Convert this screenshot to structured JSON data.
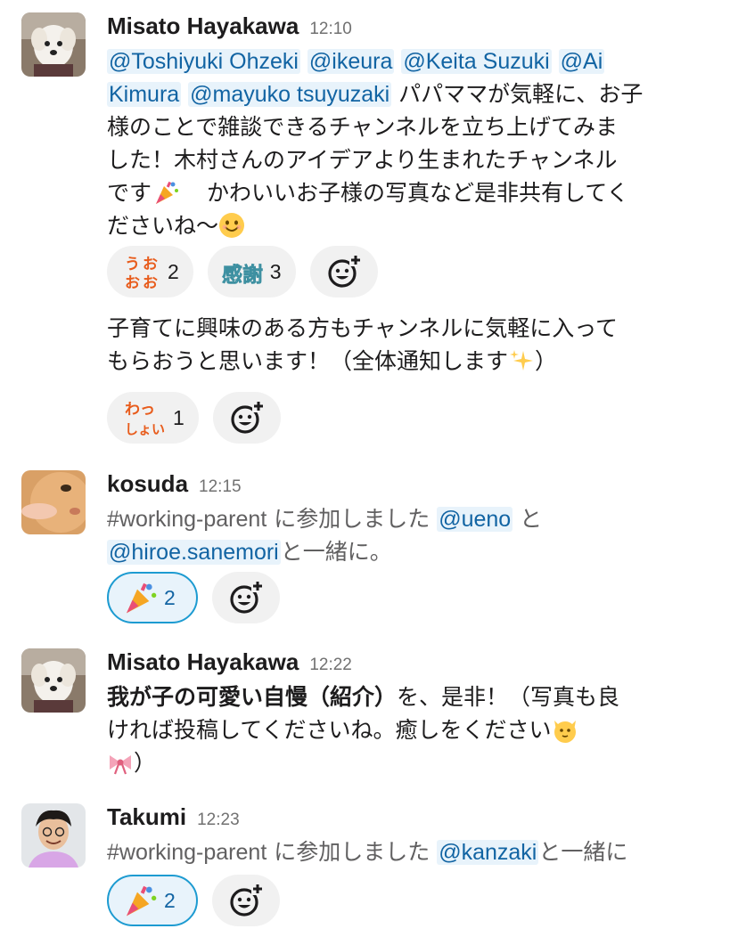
{
  "messages": [
    {
      "author": "Misato Hayakawa",
      "time": "12:10",
      "mentions": [
        "@Toshiyuki Ohzeki",
        "@ikeura",
        "@Keita Suzuki",
        "@Ai",
        "Kimura",
        "@mayuko tsuyuzaki"
      ],
      "text_1": "パパママが気軽に、お子",
      "text_2": "様のことで雑談できるチャンネルを立ち上げてみま",
      "text_3": "した！木村さんのアイデアより生まれたチャンネル",
      "text_4a": "です",
      "text_4b": "かわいいお子様の写真など是非共有してく",
      "text_5": "ださいね〜",
      "reactions": [
        {
          "emoji_name": "uooo-icon",
          "emoji_text": "うおおお",
          "count": "2"
        },
        {
          "emoji_name": "kansha-icon",
          "emoji_text": "感謝",
          "count": "3"
        }
      ],
      "followup_1": "子育てに興味のある方もチャンネルに気軽に入って",
      "followup_2": "もらおうと思います！（全体通知します",
      "followup_2_end": "）",
      "followup_reactions": [
        {
          "emoji_name": "wasshoi-icon",
          "emoji_text": "わっしょい",
          "count": "1"
        }
      ]
    },
    {
      "author": "kosuda",
      "time": "12:15",
      "channel": "#working-parent",
      "joined": "に参加しました",
      "mention_1": "@ueno",
      "conj": "と",
      "mention_2": "@hiroe.sanemori",
      "tail": "と一緒に。",
      "reaction_count": "2"
    },
    {
      "author": "Misato Hayakawa",
      "time": "12:22",
      "bold": "我が子の可愛い自慢（紹介）",
      "text_1": "を、是非！（写真も良",
      "text_2": "ければ投稿してくださいね。癒しをください",
      "text_3": "）"
    },
    {
      "author": "Takumi",
      "time": "12:23",
      "channel": "#working-parent",
      "joined": "に参加しました",
      "mention_1": "@kanzaki",
      "tail": "と一緒に",
      "reaction_count": "2"
    }
  ],
  "colors": {
    "mention_bg": "#e8f3fb",
    "mention_text": "#1264a3",
    "active_border": "#1d9bd1",
    "reaction_bg": "#f1f1f1"
  }
}
